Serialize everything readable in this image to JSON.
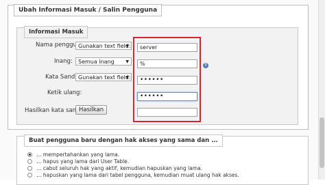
{
  "outer": {
    "legend": "Ubah Informasi Masuk / Salin Pengguna"
  },
  "login": {
    "legend": "Informasi Masuk",
    "username": {
      "label": "Nama pengguna:",
      "select": "Gunakan text field:",
      "value": "server"
    },
    "host": {
      "label": "Inang:",
      "select": "Semua inang",
      "value": "%"
    },
    "password": {
      "label": "Kata Sandi:",
      "select": "Gunakan text field:",
      "value": "••••••"
    },
    "retype": {
      "label": "Ketik ulang:",
      "value": "••••••"
    },
    "generate": {
      "label": "Hasilkan kata sandi:",
      "button": "Hasilkan",
      "value": ""
    }
  },
  "new_user": {
    "legend": "Buat pengguna baru dengan hak akses yang sama dan ...",
    "options": [
      {
        "label": "... mempertahankan yang lama.",
        "selected": true
      },
      {
        "label": "... hapus yang lama dari User Table.",
        "selected": false
      },
      {
        "label": "... cabut seluruh hak yang aktif, kemudian hapuskan yang lama.",
        "selected": false
      },
      {
        "label": "... hapuskan yang lama dari tabel pengguna, kemudian muat ulang hak akses.",
        "selected": false
      }
    ]
  },
  "colors": {
    "highlight": "#d9232d",
    "help_icon": "#4d7cc2"
  }
}
